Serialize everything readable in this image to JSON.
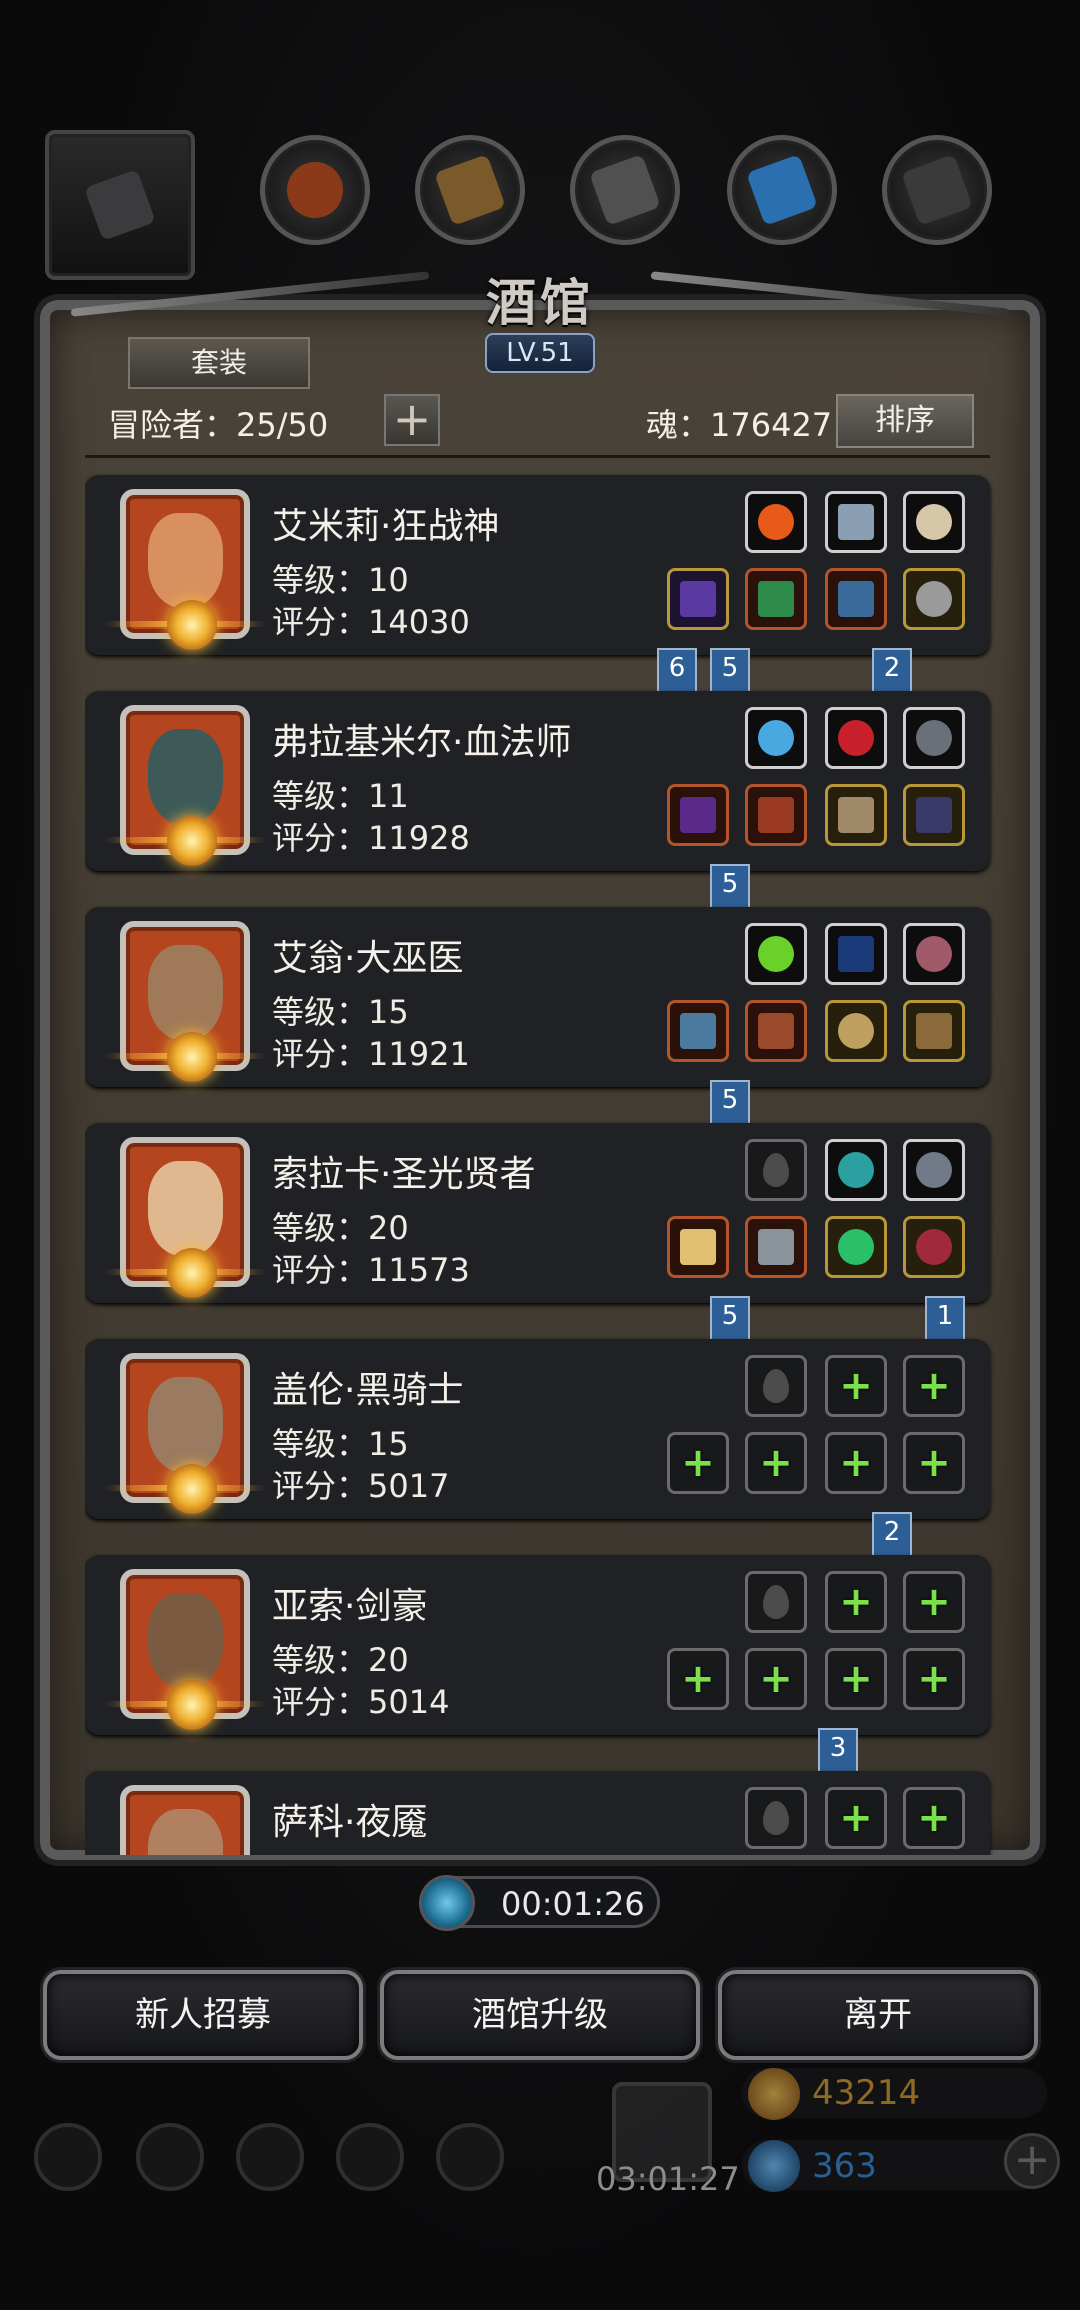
{
  "tavern": {
    "title": "酒馆",
    "level": "LV.51",
    "set_label": "套装",
    "adventurers": "冒险者：25/50",
    "add_symbol": "+",
    "soul": "魂：176427",
    "sort_label": "排序"
  },
  "heroes": [
    {
      "name": "艾米莉·狂战神",
      "level": "等级：10",
      "score": "评分：14030"
    },
    {
      "name": "弗拉基米尔·血法师",
      "level": "等级：11",
      "score": "评分：11928"
    },
    {
      "name": "艾翁·大巫医",
      "level": "等级：15",
      "score": "评分：11921"
    },
    {
      "name": "索拉卡·圣光贤者",
      "level": "等级：20",
      "score": "评分：11573"
    },
    {
      "name": "盖伦·黑骑士",
      "level": "等级：15",
      "score": "评分：5017"
    },
    {
      "name": "亚索·剑豪",
      "level": "等级：20",
      "score": "评分：5014"
    },
    {
      "name": "萨科·夜魇",
      "level": "",
      "score": ""
    }
  ],
  "flags": [
    "6",
    "5",
    "2",
    "5",
    "5",
    "5",
    "1",
    "2",
    "3"
  ],
  "timer": "00:01:26",
  "buttons": {
    "recruit": "新人招募",
    "upgrade": "酒馆升级",
    "leave": "离开"
  },
  "hud": {
    "gift_timer": "03:01:27",
    "gold": "43214",
    "gems": "363",
    "plus": "+"
  },
  "colors": {
    "flag": "#2e5e96",
    "plus_green": "#7be04a",
    "panel": "#4a4339"
  }
}
